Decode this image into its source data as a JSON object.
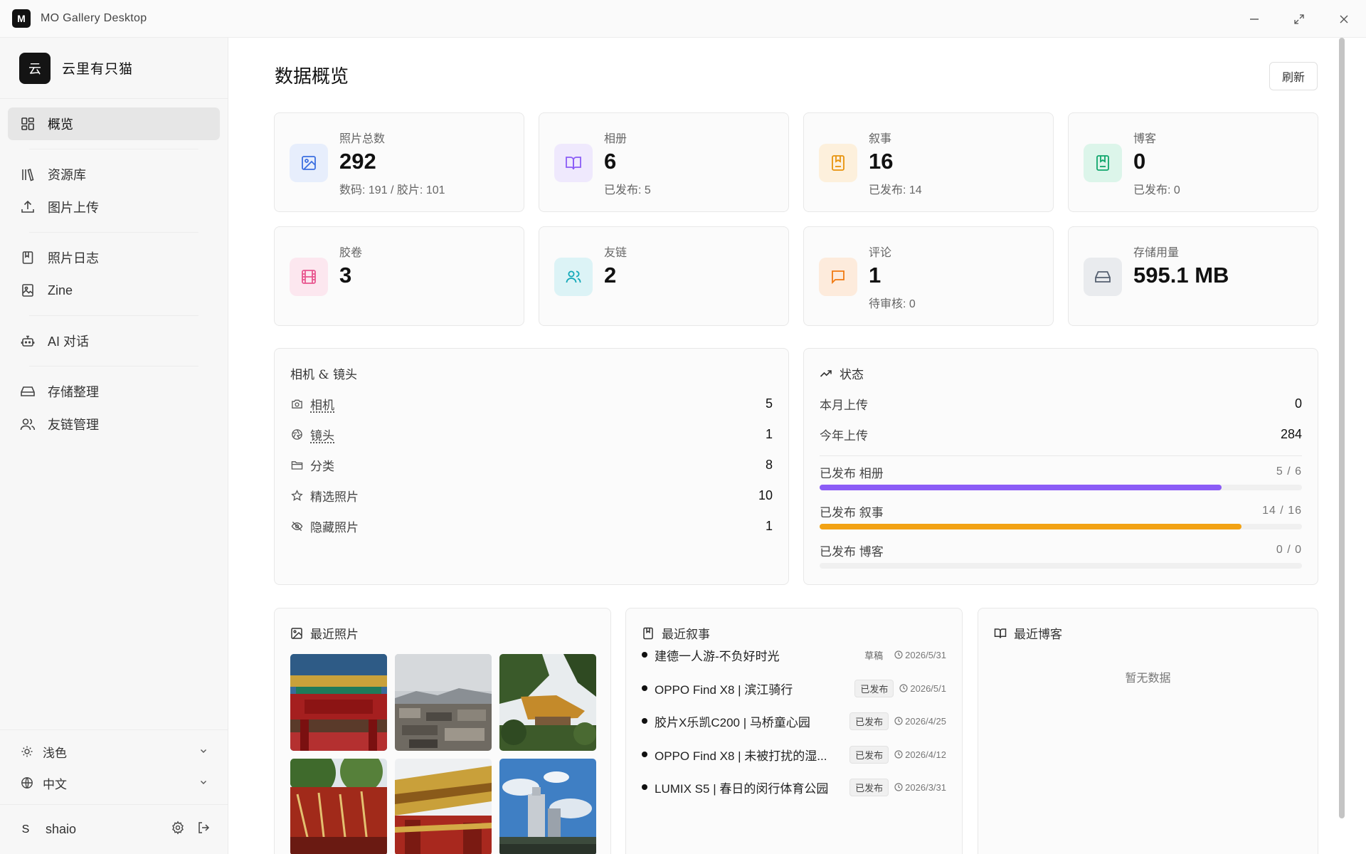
{
  "window": {
    "logo_letter": "M",
    "title": "MO Gallery Desktop"
  },
  "sidebar": {
    "brand_glyph": "云",
    "brand_name": "云里有只猫",
    "items": [
      {
        "label": "概览",
        "icon": "grid-icon"
      },
      {
        "label": "资源库",
        "icon": "library-icon"
      },
      {
        "label": "图片上传",
        "icon": "upload-icon"
      },
      {
        "label": "照片日志",
        "icon": "book-icon"
      },
      {
        "label": "Zine",
        "icon": "image-frame-icon"
      },
      {
        "label": "AI 对话",
        "icon": "robot-icon"
      },
      {
        "label": "存储整理",
        "icon": "drive-icon"
      },
      {
        "label": "友链管理",
        "icon": "users-icon"
      }
    ],
    "theme_label": "浅色",
    "language_label": "中文",
    "user_initial": "S",
    "user_name": "shaio"
  },
  "main": {
    "title": "数据概览",
    "refresh_label": "刷新",
    "stats": [
      {
        "label": "照片总数",
        "value": "292",
        "sub": "数码: 191 / 胶片: 101",
        "icon": "image-icon",
        "color": "#3b6fe0",
        "bg": "#e7eefc"
      },
      {
        "label": "相册",
        "value": "6",
        "sub": "已发布: 5",
        "icon": "open-book-icon",
        "color": "#8b5cf6",
        "bg": "#efe9fd"
      },
      {
        "label": "叙事",
        "value": "16",
        "sub": "已发布: 14",
        "icon": "bookmark-book-icon",
        "color": "#e8930c",
        "bg": "#fdf0dc"
      },
      {
        "label": "博客",
        "value": "0",
        "sub": "已发布: 0",
        "icon": "notebook-icon",
        "color": "#10a66c",
        "bg": "#dcf5ea"
      },
      {
        "label": "胶卷",
        "value": "3",
        "sub": "",
        "icon": "film-icon",
        "color": "#e8558f",
        "bg": "#fce7ef"
      },
      {
        "label": "友链",
        "value": "2",
        "sub": "",
        "icon": "users-icon",
        "color": "#12a8b8",
        "bg": "#dcf3f6"
      },
      {
        "label": "评论",
        "value": "1",
        "sub": "待审核: 0",
        "icon": "comment-icon",
        "color": "#f07a12",
        "bg": "#fdebdc"
      },
      {
        "label": "存储用量",
        "value": "595.1 MB",
        "sub": "",
        "icon": "drive-icon",
        "color": "#556070",
        "bg": "#e9ebee"
      }
    ],
    "gear": {
      "title": "相机 & 镜头",
      "rows": [
        {
          "label": "相机",
          "value": "5",
          "icon": "camera-icon"
        },
        {
          "label": "镜头",
          "value": "1",
          "icon": "aperture-icon"
        },
        {
          "label": "分类",
          "value": "8",
          "icon": "folder-icon"
        },
        {
          "label": "精选照片",
          "value": "10",
          "icon": "star-icon"
        },
        {
          "label": "隐藏照片",
          "value": "1",
          "icon": "eye-off-icon"
        }
      ]
    },
    "status": {
      "title": "状态",
      "month_label": "本月上传",
      "month_value": "0",
      "year_label": "今年上传",
      "year_value": "284",
      "bars": [
        {
          "label": "已发布 相册",
          "value": "5 / 6",
          "ratio": 0.8333,
          "color": "#8b5cf6"
        },
        {
          "label": "已发布 叙事",
          "value": "14 / 16",
          "ratio": 0.875,
          "color": "#f2a213"
        },
        {
          "label": "已发布 博客",
          "value": "0 / 0",
          "ratio": 0,
          "color": "#10a66c"
        }
      ]
    },
    "recent_photos": {
      "title": "最近照片"
    },
    "recent_stories": {
      "title": "最近叙事",
      "items": [
        {
          "title": "建德一人游-不负好时光",
          "status": "草稿",
          "date": "2026/5/31"
        },
        {
          "title": "OPPO Find X8 | 滨江骑行",
          "status": "已发布",
          "date": "2026/5/1"
        },
        {
          "title": "胶片X乐凯C200 | 马桥童心园",
          "status": "已发布",
          "date": "2026/4/25"
        },
        {
          "title": "OPPO Find X8 | 未被打扰的湿...",
          "status": "已发布",
          "date": "2026/4/12"
        },
        {
          "title": "LUMIX S5 | 春日的闵行体育公园",
          "status": "已发布",
          "date": "2026/3/31"
        }
      ]
    },
    "recent_blogs": {
      "title": "最近博客",
      "empty": "暂无数据"
    }
  }
}
